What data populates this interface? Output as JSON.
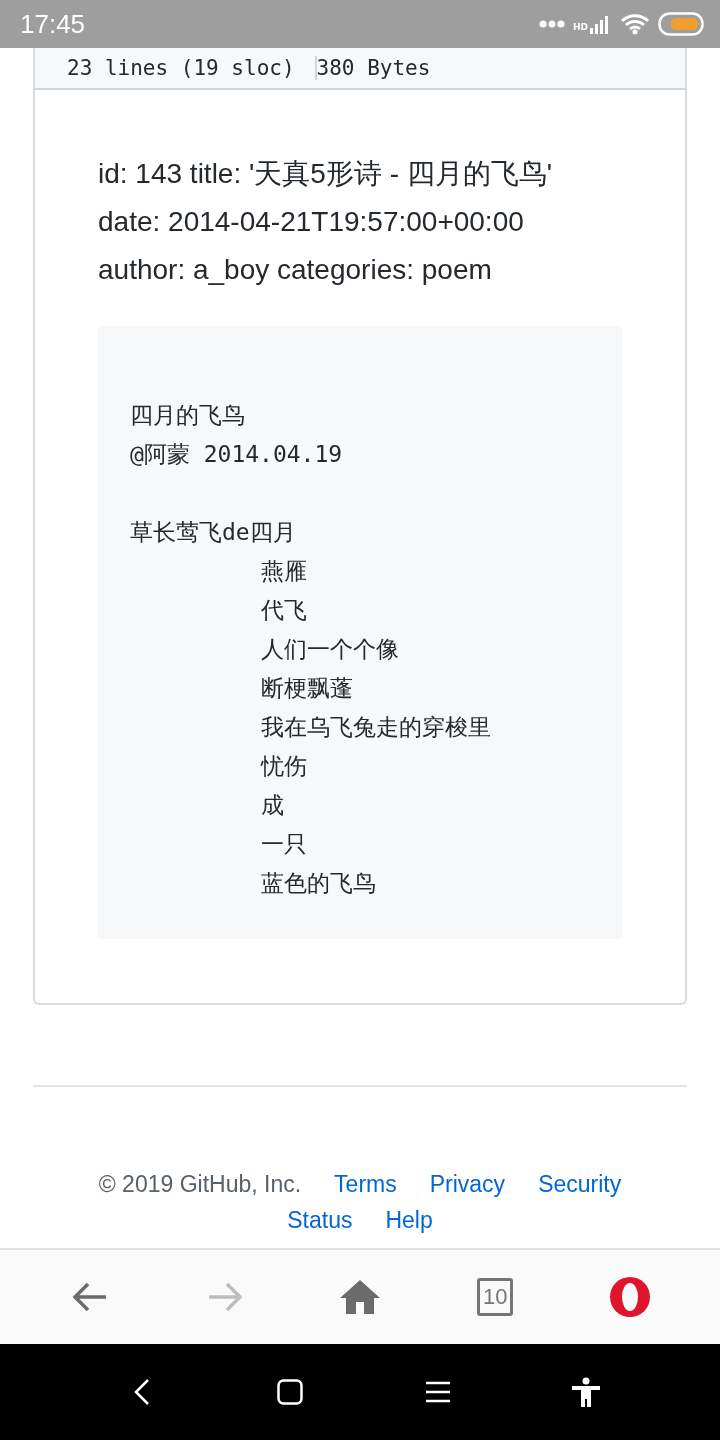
{
  "status_bar": {
    "time": "17:45",
    "network_label": "HD"
  },
  "file_info": {
    "lines": "23 lines (19 sloc)",
    "size": "380 Bytes"
  },
  "front_matter": [
    "id: 143 title: '天真5形诗 - 四月的飞鸟'",
    "date: 2014-04-21T19:57:00+00:00",
    "author: a_boy categories: poem"
  ],
  "code_stanzas": [
    {
      "lines": [
        {
          "text": "四月的飞鸟",
          "indented": false
        },
        {
          "text": "@阿蒙 2014.04.19",
          "indented": false
        }
      ]
    },
    {
      "lines": [
        {
          "text": "草长莺飞de四月",
          "indented": false
        },
        {
          "text": "燕雁",
          "indented": true
        },
        {
          "text": "代飞",
          "indented": true
        },
        {
          "text": "人们一个个像",
          "indented": true
        },
        {
          "text": "断梗飘蓬",
          "indented": true
        },
        {
          "text": "我在乌飞兔走的穿梭里",
          "indented": true
        },
        {
          "text": "忧伤",
          "indented": true
        },
        {
          "text": "成",
          "indented": true
        },
        {
          "text": "一只",
          "indented": true
        },
        {
          "text": "蓝色的飞鸟",
          "indented": true
        }
      ]
    }
  ],
  "footer": {
    "copyright": "© 2019 GitHub, Inc.",
    "links": [
      "Terms",
      "Privacy",
      "Security",
      "Status",
      "Help"
    ]
  },
  "browser_bar": {
    "tab_count": "10",
    "forward_disabled": true
  }
}
